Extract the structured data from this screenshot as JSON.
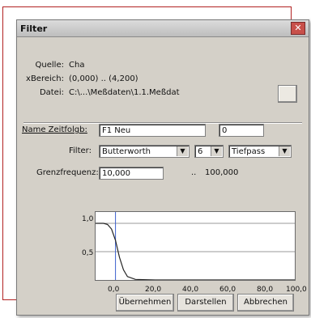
{
  "dialog": {
    "title": "Filter",
    "close_glyph": "✕"
  },
  "info": {
    "items": [
      {
        "key": "Quelle:",
        "value": "Cha"
      },
      {
        "key": "xBereich:",
        "value": "(0,000) .. (4,200)"
      },
      {
        "key": "Datei:",
        "value": "C:\\...\\Meßdaten\\1.1.Meßdat"
      }
    ]
  },
  "form": {
    "name_label": "Name Zeitfolgb:",
    "name_value": "F1 Neu",
    "name_extra": "0",
    "filter_label": "Filter:",
    "filter_type": "Butterworth",
    "order": "6",
    "pass_type": "Tiefpass",
    "cutoff_label": "Grenzfrequenz:",
    "cutoff_value": "10,000",
    "range_separator": "..",
    "cutoff_max": "100,000"
  },
  "plot": {
    "y_ticks": [
      "1,0",
      "0,5"
    ],
    "x_ticks": [
      "0,0",
      "20,0",
      "40,0",
      "60,0",
      "80,0",
      "100,0"
    ]
  },
  "chart_data": {
    "type": "line",
    "x": [
      0,
      2,
      4,
      6,
      8,
      10,
      12,
      14,
      16,
      20,
      30,
      50,
      100
    ],
    "series": [
      {
        "values": [
          1.0,
          1.0,
          1.0,
          0.98,
          0.9,
          0.7,
          0.4,
          0.18,
          0.06,
          0.01,
          0.0,
          0.0,
          0.0
        ]
      }
    ],
    "xlim": [
      0,
      100
    ],
    "ylim": [
      0,
      1.2
    ]
  },
  "buttons": {
    "apply": "Übernehmen",
    "preview": "Darstellen",
    "cancel": "Abbrechen"
  }
}
